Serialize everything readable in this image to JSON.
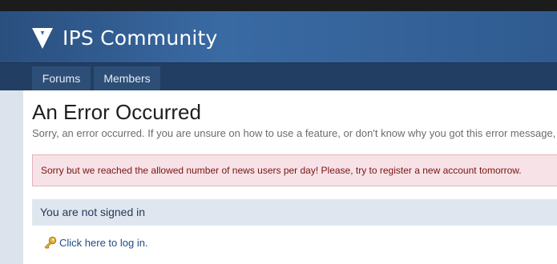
{
  "header": {
    "logo_text": "IPS Community",
    "logo_icon": "ips-v-logo-icon"
  },
  "nav": {
    "tabs": [
      {
        "label": "Forums"
      },
      {
        "label": "Members"
      }
    ]
  },
  "main": {
    "title": "An Error Occurred",
    "description": "Sorry, an error occurred. If you are unsure on how to use a feature, or don't know why you got this error message,",
    "error_message": "Sorry but we reached the allowed number of news users per day! Please, try to register a new account tomorrow.",
    "signin_heading": "You are not signed in",
    "login_link": "Click here to log in.",
    "login_icon": "key-icon"
  },
  "colors": {
    "header_blue": "#3a6aa3",
    "nav_dark": "#223f63",
    "error_bg": "#f7e3e7",
    "error_text": "#7a1212",
    "link_blue": "#1f4c85"
  }
}
